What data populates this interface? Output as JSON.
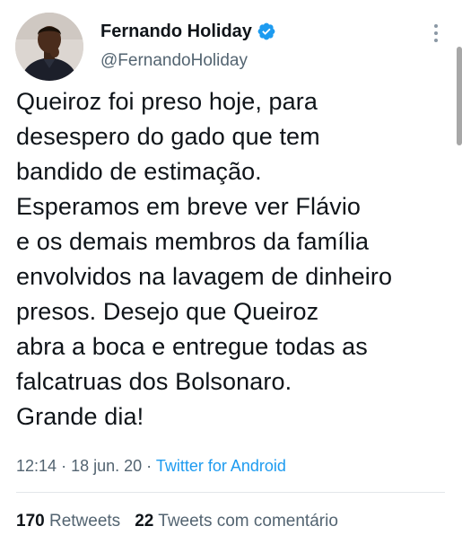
{
  "author": {
    "name": "Fernando Holiday",
    "handle": "@FernandoHoliday",
    "verified": true,
    "avatar_icon": "person-photo"
  },
  "tweet": {
    "lines": [
      "Queiroz foi preso hoje, para",
      "desespero do gado que tem",
      "bandido de estimação.",
      "Esperamos em breve ver Flávio",
      "e os demais membros da família",
      "envolvidos na lavagem de dinheiro",
      "presos. Desejo que Queiroz",
      "abra a boca e entregue todas as",
      "falcatruas dos Bolsonaro.",
      "Grande dia!"
    ],
    "time": "12:14",
    "separator": "·",
    "date": "18 jun. 20",
    "source": "Twitter for Android"
  },
  "stats": {
    "retweets_count": "170",
    "retweets_label": "Retweets",
    "quotes_count": "22",
    "quotes_label": "Tweets com comentário"
  },
  "colors": {
    "verified_badge": "#1d9bf0",
    "secondary_text": "#536471",
    "link": "#1d9bf0",
    "primary_text": "#0f1419"
  }
}
